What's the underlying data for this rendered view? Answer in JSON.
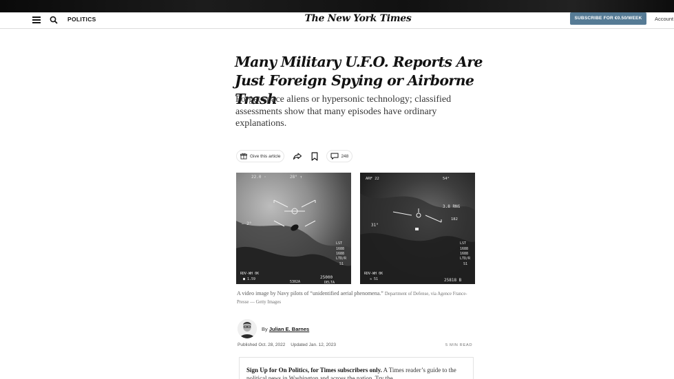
{
  "header": {
    "section_label": "POLITICS",
    "logo_text": "The New York Times",
    "subscribe_label": "SUBSCRIBE FOR €0.50/WEEK",
    "account_label": "Account"
  },
  "article": {
    "headline": "Many Military U.F.O. Reports Are Just Foreign Spying or Airborne Trash",
    "summary": "Forget space aliens or hypersonic technology; classified assessments show that many episodes have ordinary explanations.",
    "share_tools": {
      "gift_label": "Give this article",
      "comment_count": "248"
    },
    "images": [
      {
        "overlay": {
          "top_left": "22.0 ◦",
          "top_mid": "28° ↑",
          "left_mid": "— 2°",
          "right_block": "LST\n1688\n1688\nLTD/R\nS1",
          "bottom_left": "RDV-WH 0K\n■ 1.59",
          "bottom_mid": "5302A",
          "bottom_right": "25000\nDELTA"
        }
      },
      {
        "overlay": {
          "top_left": "ARF 22",
          "top_right": "54°",
          "range": "3.8 RNG",
          "right_top": "182",
          "left_mid": "31°",
          "right_block": "LST\n1688\n1688\nLTD/R\nS1",
          "bottom_left": "RDV-WH 0K\n≈ 51",
          "bottom_right": "25818 B"
        }
      }
    ],
    "caption": {
      "text": "A video image by Navy pilots of “unidentified aerial phenomena.”",
      "credit": "Department of Defense, via Agence France-Presse — Getty Images"
    },
    "byline": {
      "prefix": "By",
      "author": "Julian E. Barnes"
    },
    "dates": {
      "published": "Published Oct. 28, 2022",
      "updated": "Updated Jan. 12, 2023"
    },
    "read_time": "5 MIN READ",
    "signup": {
      "bold": "Sign Up for On Politics, for Times subscribers only.",
      "text": " A Times reader’s guide to the political news in Washington and across the nation. Try the"
    }
  }
}
